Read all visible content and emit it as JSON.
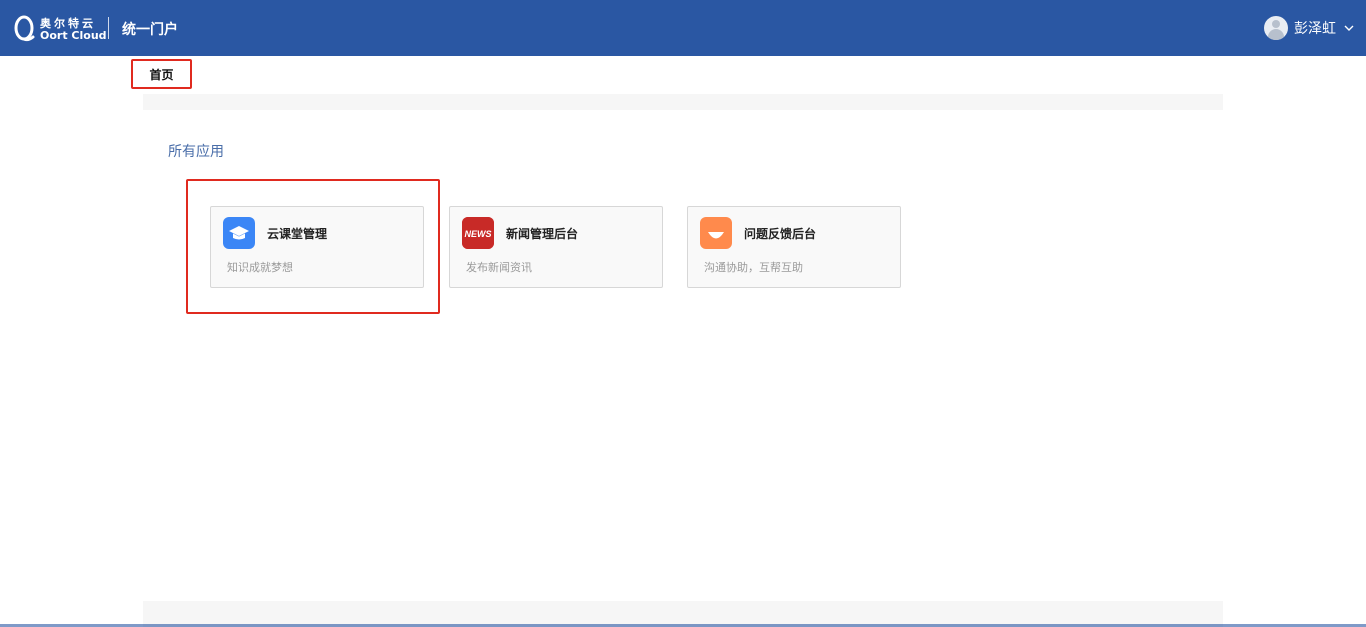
{
  "header": {
    "logo_cn": "奥尔特云",
    "logo_en": "Oort Cloud",
    "portal_title": "统一门户",
    "user_name": "彭泽虹"
  },
  "nav": {
    "home_tab": "首页"
  },
  "section": {
    "title": "所有应用"
  },
  "apps": [
    {
      "name": "云课堂管理",
      "desc": "知识成就梦想",
      "icon": "graduation-cap-icon",
      "color": "#3b86f6"
    },
    {
      "name": "新闻管理后台",
      "desc": "发布新闻资讯",
      "icon": "news-icon",
      "color": "#d7322f",
      "icon_text": "NEWS"
    },
    {
      "name": "问题反馈后台",
      "desc": "沟通协助，互帮互助",
      "icon": "smile-icon",
      "color": "#ff8a4c"
    }
  ],
  "colors": {
    "header_bg": "#2a57a3",
    "highlight": "#e02a1f",
    "section_title": "#4a6ea9"
  }
}
